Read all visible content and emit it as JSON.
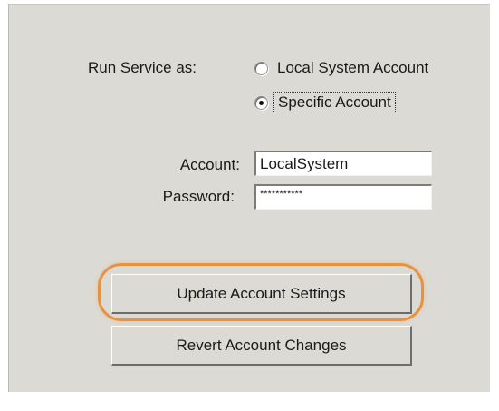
{
  "run_service": {
    "label": "Run Service as:",
    "options": [
      {
        "label": "Local System Account",
        "selected": false
      },
      {
        "label": "Specific Account",
        "selected": true
      }
    ]
  },
  "account": {
    "label": "Account:",
    "value": "LocalSystem"
  },
  "password": {
    "label": "Password:",
    "value": "***********"
  },
  "buttons": {
    "update_label": "Update Account Settings",
    "revert_label": "Revert Account Changes"
  },
  "colors": {
    "panel_background": "#dcdad5",
    "highlight_ring": "#e8923b"
  }
}
